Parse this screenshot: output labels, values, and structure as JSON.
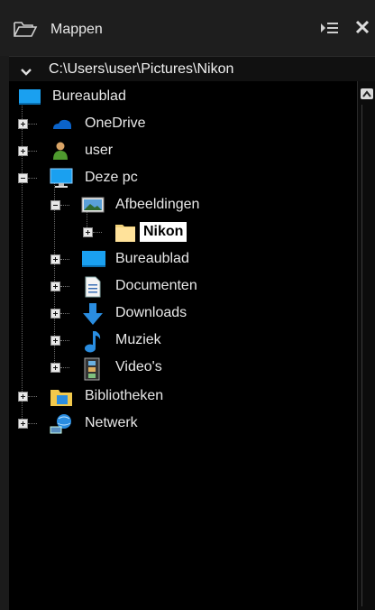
{
  "header": {
    "title": "Mappen"
  },
  "pathbar": {
    "path": "C:\\Users\\user\\Pictures\\Nikon"
  },
  "tree": {
    "root": "Bureaublad",
    "onedrive": "OneDrive",
    "user": "user",
    "this_pc": "Deze pc",
    "pictures": "Afbeeldingen",
    "nikon": "Nikon",
    "desktop": "Bureaublad",
    "documents": "Documenten",
    "downloads": "Downloads",
    "music": "Muziek",
    "videos": "Video's",
    "libraries": "Bibliotheken",
    "network": "Netwerk"
  },
  "colors": {
    "background": "#000000",
    "panel": "#1b1b1b",
    "selection": "#ffffff"
  },
  "icons": [
    "folder-outline-icon",
    "list-toggle-icon",
    "close-icon",
    "chevron-down-icon",
    "desktop-icon",
    "cloud-icon",
    "user-icon",
    "computer-icon",
    "pictures-icon",
    "folder-icon",
    "document-icon",
    "download-arrow-icon",
    "music-note-icon",
    "film-icon",
    "libraries-icon",
    "network-icon"
  ]
}
